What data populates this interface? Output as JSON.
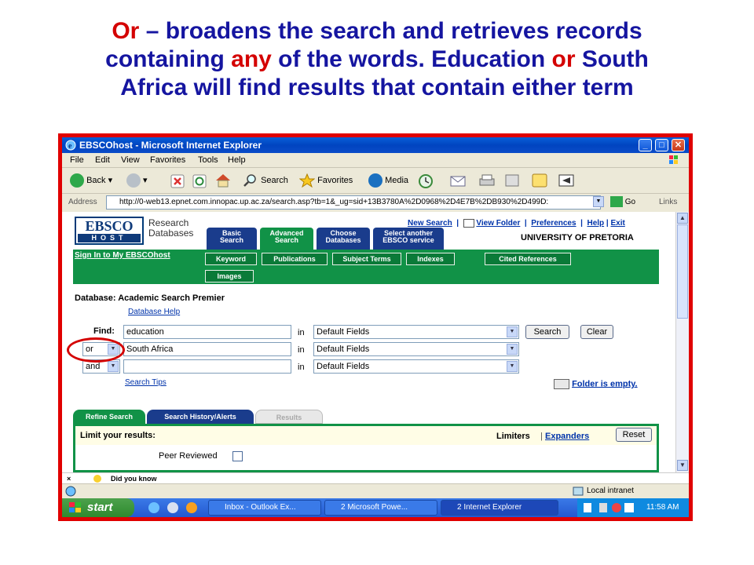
{
  "slide": {
    "line1_pre": "Or",
    "line1_rest": " – broadens the search and retrieves records",
    "line2_pre": "containing ",
    "line2_any": "any",
    "line2_mid": " of the words. Education ",
    "line2_or": "or",
    "line2_post": " South",
    "line3": "Africa will find results that contain either term"
  },
  "window": {
    "title": "EBSCOhost - Microsoft Internet Explorer",
    "menu": [
      "File",
      "Edit",
      "View",
      "Favorites",
      "Tools",
      "Help"
    ],
    "toolbar": {
      "back": "Back",
      "search": "Search",
      "favorites": "Favorites",
      "media": "Media"
    },
    "address_label": "Address",
    "address_url": "http://0-web13.epnet.com.innopac.up.ac.za/search.asp?tb=1&_ug=sid+13B3780A%2D0968%2D4E7B%2DB930%2D499D:",
    "go": "Go",
    "links": "Links"
  },
  "ebsco": {
    "logo_top": "EBSCO",
    "logo_bottom": "HOST",
    "research": "Research",
    "databases": "Databases",
    "links": [
      "New Search",
      "View Folder",
      "Preferences",
      "Help",
      "Exit"
    ],
    "university": "UNIVERSITY OF PRETORIA",
    "main_tabs": [
      {
        "l1": "Basic",
        "l2": "Search"
      },
      {
        "l1": "Advanced",
        "l2": "Search"
      },
      {
        "l1": "Choose",
        "l2": "Databases"
      },
      {
        "l1": "Select another",
        "l2": "EBSCO service"
      }
    ],
    "signin": "Sign In to My EBSCOhost",
    "sub_tabs": [
      "Keyword",
      "Publications",
      "Subject Terms",
      "Indexes",
      "Cited References",
      "Images"
    ],
    "database_line": "Database: Academic Search Premier",
    "database_help": "Database Help",
    "find_label": "Find:",
    "rows": [
      {
        "op": "",
        "term": "education",
        "in": "in",
        "field": "Default Fields"
      },
      {
        "op": "or",
        "term": "South Africa",
        "in": "in",
        "field": "Default Fields"
      },
      {
        "op": "and",
        "term": "",
        "in": "in",
        "field": "Default Fields"
      }
    ],
    "search_button": "Search",
    "clear_button": "Clear",
    "search_tips": "Search Tips",
    "folder_empty": "Folder is empty.",
    "lower_tabs": [
      "Refine Search",
      "Search History/Alerts",
      "Results"
    ],
    "limit_title": "Limit your results:",
    "limiters": "Limiters",
    "expanders": "Expanders",
    "reset": "Reset",
    "peer_reviewed": "Peer Reviewed",
    "did_you_know": "Did you know"
  },
  "status": {
    "zone": "Local intranet"
  },
  "taskbar": {
    "start": "start",
    "tasks": [
      "Inbox - Outlook Ex...",
      "2 Microsoft Powe...",
      "2 Internet Explorer"
    ],
    "clock": "11:58 AM"
  },
  "colors": {
    "slide_blue": "#1515a0",
    "slide_red": "#d40000",
    "ebsco_green": "#119247",
    "ebsco_navy": "#1a3c8c"
  }
}
